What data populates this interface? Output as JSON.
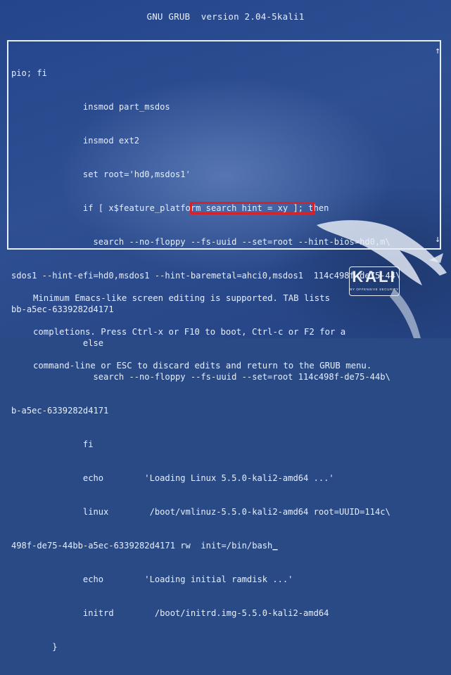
{
  "header": {
    "title": "GNU GRUB  version 2.04-5kali1"
  },
  "editor": {
    "lines": [
      "pio; fi",
      "              insmod part_msdos",
      "              insmod ext2",
      "              set root='hd0,msdos1'",
      "              if [ x$feature_platform_search_hint = xy ]; then",
      "                search --no-floppy --fs-uuid --set=root --hint-bios=hd0,m\\",
      "sdos1 --hint-efi=hd0,msdos1 --hint-baremetal=ahci0,msdos1  114c498f-de75-44\\",
      "bb-a5ec-6339282d4171",
      "              else",
      "                search --no-floppy --fs-uuid --set=root 114c498f-de75-44b\\",
      "b-a5ec-6339282d4171",
      "              fi",
      "              echo        'Loading Linux 5.5.0-kali2-amd64 ...'",
      "              linux        /boot/vmlinuz-5.5.0-kali2-amd64 root=UUID=114c\\",
      "498f-de75-44bb-a5ec-6339282d4171 rw  init=/bin/bash",
      "              echo        'Loading initial ramdisk ...'",
      "              initrd        /boot/initrd.img-5.5.0-kali2-amd64",
      "        }"
    ],
    "cursor_char": "_",
    "scroll_up_icon": "↑",
    "scroll_down_icon": "↓"
  },
  "help": {
    "lines": [
      "Minimum Emacs-like screen editing is supported. TAB lists",
      "completions. Press Ctrl-x or F10 to boot, Ctrl-c or F2 for a",
      "command-line or ESC to discard edits and return to the GRUB menu."
    ]
  },
  "logo": {
    "name": "KALI",
    "tagline": "BY OFFENSIVE SECURITY"
  },
  "colors": {
    "background": "#2a4a86",
    "text": "#e8eef8",
    "highlight_box": "#d6232a"
  }
}
